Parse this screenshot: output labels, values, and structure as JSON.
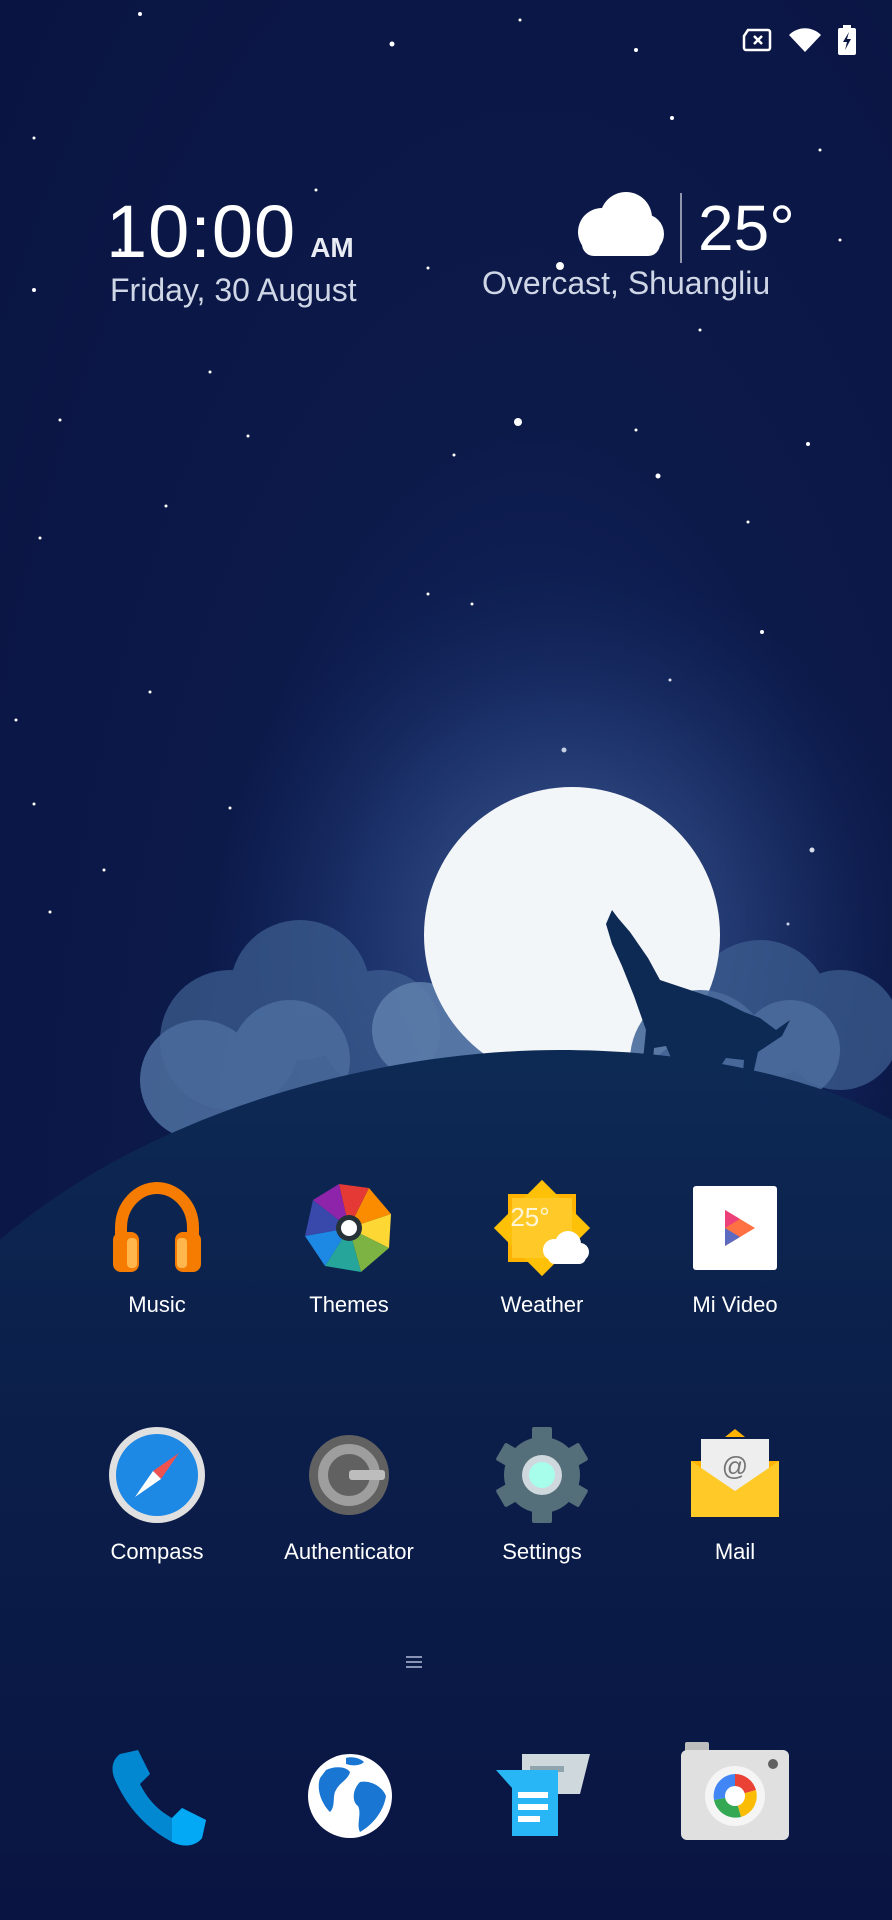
{
  "status_bar": {
    "icons": [
      "sim-off-icon",
      "wifi-icon",
      "battery-charging-icon"
    ]
  },
  "clock": {
    "time": "10:00",
    "ampm": "AM",
    "date": "Friday, 30 August"
  },
  "weather": {
    "icon": "cloud-icon",
    "temperature": "25°",
    "description": "Overcast, Shuangliu"
  },
  "apps": [
    {
      "label": "Music",
      "icon": "headphones-icon"
    },
    {
      "label": "Themes",
      "icon": "themes-pinwheel-icon"
    },
    {
      "label": "Weather",
      "icon": "weather-app-icon",
      "icon_text": "25°"
    },
    {
      "label": "Mi Video",
      "icon": "play-icon"
    },
    {
      "label": "Compass",
      "icon": "compass-icon"
    },
    {
      "label": "Authenticator",
      "icon": "authenticator-icon"
    },
    {
      "label": "Settings",
      "icon": "gear-icon"
    },
    {
      "label": "Mail",
      "icon": "mail-icon",
      "icon_text": "@"
    }
  ],
  "dock": [
    {
      "icon": "phone-icon"
    },
    {
      "icon": "browser-globe-icon"
    },
    {
      "icon": "messages-icon"
    },
    {
      "icon": "camera-icon"
    }
  ],
  "colors": {
    "sky_dark": "#0a1442",
    "sky_glow": "#2a4a85",
    "moon": "#f3f6f8",
    "hill": "#0b2046",
    "music_orange": "#f57c00",
    "settings_accent": "#a7ffeb",
    "mail_yellow": "#ffca28"
  }
}
